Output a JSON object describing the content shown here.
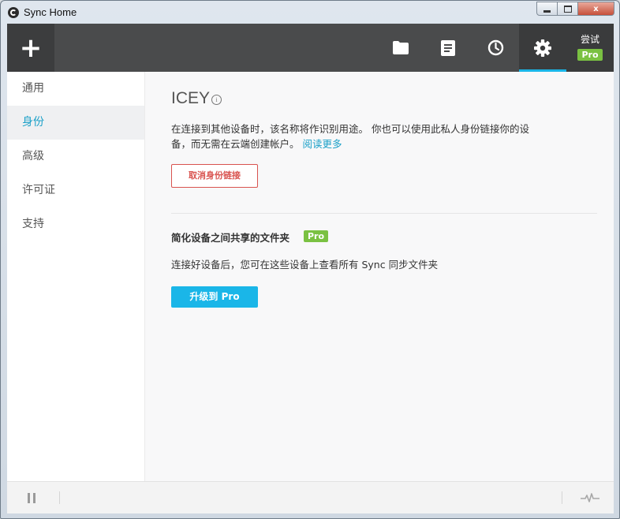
{
  "window": {
    "title": "Sync Home",
    "controls": {
      "minimize": "minimize",
      "maximize": "maximize",
      "close": "x"
    }
  },
  "toolbar": {
    "add_label": "+",
    "buttons": [
      {
        "icon": "folder-icon",
        "active": false
      },
      {
        "icon": "notes-icon",
        "active": false
      },
      {
        "icon": "clock-icon",
        "active": false
      },
      {
        "icon": "gear-icon",
        "active": true
      }
    ],
    "trial_label": "尝试",
    "trial_badge": "Pro"
  },
  "sidebar": {
    "items": [
      {
        "label": "通用",
        "active": false
      },
      {
        "label": "身份",
        "active": true
      },
      {
        "label": "高级",
        "active": false
      },
      {
        "label": "许可证",
        "active": false
      },
      {
        "label": "支持",
        "active": false
      }
    ]
  },
  "identity": {
    "name": "ICEY",
    "info_icon": "i",
    "description_1": "在连接到其他设备时，该名称将作识别用途。 你也可以使用此私人身份链接你的设备，而无需在云端创建帐户。",
    "learn_more": "阅读更多",
    "unlink_button": "取消身份链接"
  },
  "pro_section": {
    "title": "简化设备之间共享的文件夹",
    "badge": "Pro",
    "description": "连接好设备后，您可在这些设备上查看所有 Sync 同步文件夹",
    "upgrade_button": "升级到 Pro"
  },
  "colors": {
    "accent": "#1ab6e8",
    "toolbar_bg": "#4a4b4c",
    "pro_green": "#7ac142",
    "danger": "#d9534f"
  }
}
